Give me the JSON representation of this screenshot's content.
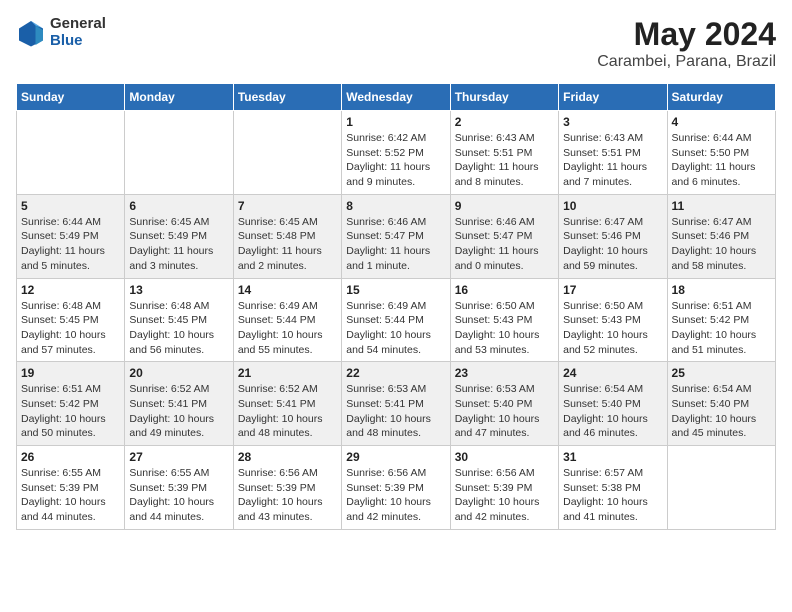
{
  "header": {
    "logo": {
      "line1": "General",
      "line2": "Blue"
    },
    "title": "May 2024",
    "location": "Carambei, Parana, Brazil"
  },
  "days_of_week": [
    "Sunday",
    "Monday",
    "Tuesday",
    "Wednesday",
    "Thursday",
    "Friday",
    "Saturday"
  ],
  "weeks": [
    [
      {
        "day": "",
        "info": ""
      },
      {
        "day": "",
        "info": ""
      },
      {
        "day": "",
        "info": ""
      },
      {
        "day": "1",
        "info": "Sunrise: 6:42 AM\nSunset: 5:52 PM\nDaylight: 11 hours and 9 minutes."
      },
      {
        "day": "2",
        "info": "Sunrise: 6:43 AM\nSunset: 5:51 PM\nDaylight: 11 hours and 8 minutes."
      },
      {
        "day": "3",
        "info": "Sunrise: 6:43 AM\nSunset: 5:51 PM\nDaylight: 11 hours and 7 minutes."
      },
      {
        "day": "4",
        "info": "Sunrise: 6:44 AM\nSunset: 5:50 PM\nDaylight: 11 hours and 6 minutes."
      }
    ],
    [
      {
        "day": "5",
        "info": "Sunrise: 6:44 AM\nSunset: 5:49 PM\nDaylight: 11 hours and 5 minutes."
      },
      {
        "day": "6",
        "info": "Sunrise: 6:45 AM\nSunset: 5:49 PM\nDaylight: 11 hours and 3 minutes."
      },
      {
        "day": "7",
        "info": "Sunrise: 6:45 AM\nSunset: 5:48 PM\nDaylight: 11 hours and 2 minutes."
      },
      {
        "day": "8",
        "info": "Sunrise: 6:46 AM\nSunset: 5:47 PM\nDaylight: 11 hours and 1 minute."
      },
      {
        "day": "9",
        "info": "Sunrise: 6:46 AM\nSunset: 5:47 PM\nDaylight: 11 hours and 0 minutes."
      },
      {
        "day": "10",
        "info": "Sunrise: 6:47 AM\nSunset: 5:46 PM\nDaylight: 10 hours and 59 minutes."
      },
      {
        "day": "11",
        "info": "Sunrise: 6:47 AM\nSunset: 5:46 PM\nDaylight: 10 hours and 58 minutes."
      }
    ],
    [
      {
        "day": "12",
        "info": "Sunrise: 6:48 AM\nSunset: 5:45 PM\nDaylight: 10 hours and 57 minutes."
      },
      {
        "day": "13",
        "info": "Sunrise: 6:48 AM\nSunset: 5:45 PM\nDaylight: 10 hours and 56 minutes."
      },
      {
        "day": "14",
        "info": "Sunrise: 6:49 AM\nSunset: 5:44 PM\nDaylight: 10 hours and 55 minutes."
      },
      {
        "day": "15",
        "info": "Sunrise: 6:49 AM\nSunset: 5:44 PM\nDaylight: 10 hours and 54 minutes."
      },
      {
        "day": "16",
        "info": "Sunrise: 6:50 AM\nSunset: 5:43 PM\nDaylight: 10 hours and 53 minutes."
      },
      {
        "day": "17",
        "info": "Sunrise: 6:50 AM\nSunset: 5:43 PM\nDaylight: 10 hours and 52 minutes."
      },
      {
        "day": "18",
        "info": "Sunrise: 6:51 AM\nSunset: 5:42 PM\nDaylight: 10 hours and 51 minutes."
      }
    ],
    [
      {
        "day": "19",
        "info": "Sunrise: 6:51 AM\nSunset: 5:42 PM\nDaylight: 10 hours and 50 minutes."
      },
      {
        "day": "20",
        "info": "Sunrise: 6:52 AM\nSunset: 5:41 PM\nDaylight: 10 hours and 49 minutes."
      },
      {
        "day": "21",
        "info": "Sunrise: 6:52 AM\nSunset: 5:41 PM\nDaylight: 10 hours and 48 minutes."
      },
      {
        "day": "22",
        "info": "Sunrise: 6:53 AM\nSunset: 5:41 PM\nDaylight: 10 hours and 48 minutes."
      },
      {
        "day": "23",
        "info": "Sunrise: 6:53 AM\nSunset: 5:40 PM\nDaylight: 10 hours and 47 minutes."
      },
      {
        "day": "24",
        "info": "Sunrise: 6:54 AM\nSunset: 5:40 PM\nDaylight: 10 hours and 46 minutes."
      },
      {
        "day": "25",
        "info": "Sunrise: 6:54 AM\nSunset: 5:40 PM\nDaylight: 10 hours and 45 minutes."
      }
    ],
    [
      {
        "day": "26",
        "info": "Sunrise: 6:55 AM\nSunset: 5:39 PM\nDaylight: 10 hours and 44 minutes."
      },
      {
        "day": "27",
        "info": "Sunrise: 6:55 AM\nSunset: 5:39 PM\nDaylight: 10 hours and 44 minutes."
      },
      {
        "day": "28",
        "info": "Sunrise: 6:56 AM\nSunset: 5:39 PM\nDaylight: 10 hours and 43 minutes."
      },
      {
        "day": "29",
        "info": "Sunrise: 6:56 AM\nSunset: 5:39 PM\nDaylight: 10 hours and 42 minutes."
      },
      {
        "day": "30",
        "info": "Sunrise: 6:56 AM\nSunset: 5:39 PM\nDaylight: 10 hours and 42 minutes."
      },
      {
        "day": "31",
        "info": "Sunrise: 6:57 AM\nSunset: 5:38 PM\nDaylight: 10 hours and 41 minutes."
      },
      {
        "day": "",
        "info": ""
      }
    ]
  ]
}
